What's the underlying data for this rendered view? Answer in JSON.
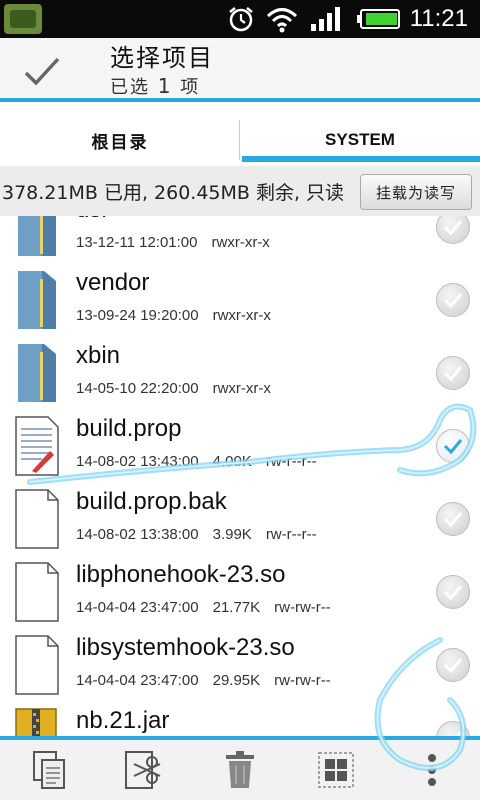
{
  "status_bar": {
    "time": "11:21"
  },
  "action_bar": {
    "title": "选择项目",
    "subtitle_prefix": "已选",
    "subtitle_count": "1",
    "subtitle_suffix": "项"
  },
  "tabs": [
    {
      "label": "根目录",
      "selected": false
    },
    {
      "label": "SYSTEM",
      "selected": true
    }
  ],
  "storage": {
    "info": "378.21MB 已用, 260.45MB 剩余, 只读",
    "mount_button": "挂载为读写"
  },
  "files": [
    {
      "name": "usr",
      "date": "13-12-11 12:01:00",
      "size": "",
      "perms": "rwxr-xr-x",
      "type": "folder",
      "checked": false
    },
    {
      "name": "vendor",
      "date": "13-09-24 19:20:00",
      "size": "",
      "perms": "rwxr-xr-x",
      "type": "folder",
      "checked": false
    },
    {
      "name": "xbin",
      "date": "14-05-10 22:20:00",
      "size": "",
      "perms": "rwxr-xr-x",
      "type": "folder",
      "checked": false
    },
    {
      "name": "build.prop",
      "date": "14-08-02 13:43:00",
      "size": "4.00K",
      "perms": "rw-r--r--",
      "type": "text",
      "checked": true
    },
    {
      "name": "build.prop.bak",
      "date": "14-08-02 13:38:00",
      "size": "3.99K",
      "perms": "rw-r--r--",
      "type": "file",
      "checked": false
    },
    {
      "name": "libphonehook-23.so",
      "date": "14-04-04 23:47:00",
      "size": "21.77K",
      "perms": "rw-rw-r--",
      "type": "file",
      "checked": false
    },
    {
      "name": "libsystemhook-23.so",
      "date": "14-04-04 23:47:00",
      "size": "29.95K",
      "perms": "rw-rw-r--",
      "type": "file",
      "checked": false
    },
    {
      "name": "nb.21.jar",
      "date": "",
      "size": "",
      "perms": "",
      "type": "jar",
      "checked": false
    }
  ],
  "bottom_bar": {
    "icons": [
      "copy-icon",
      "cut-icon",
      "delete-icon",
      "select-all-icon",
      "more-icon"
    ]
  },
  "colors": {
    "accent": "#27a9e1",
    "check_selected": "#27a9e1"
  }
}
